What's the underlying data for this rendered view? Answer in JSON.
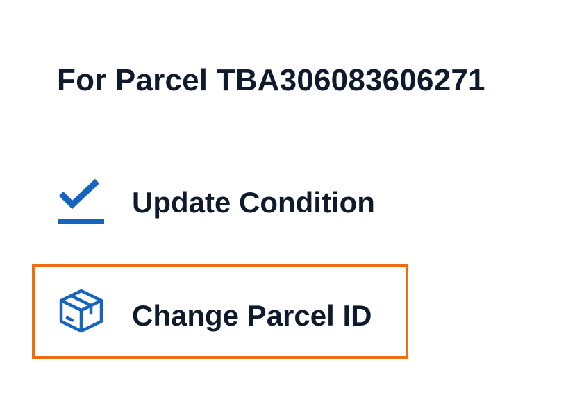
{
  "header": {
    "title": "For Parcel TBA306083606271"
  },
  "actions": [
    {
      "label": "Update Condition",
      "icon": "checkmark-underline-icon",
      "selected": false
    },
    {
      "label": "Change Parcel ID",
      "icon": "package-box-icon",
      "selected": true
    }
  ],
  "colors": {
    "text": "#0f1b2d",
    "icon": "#1565c0",
    "highlight_border": "#ef6c0f",
    "background": "#ffffff"
  }
}
